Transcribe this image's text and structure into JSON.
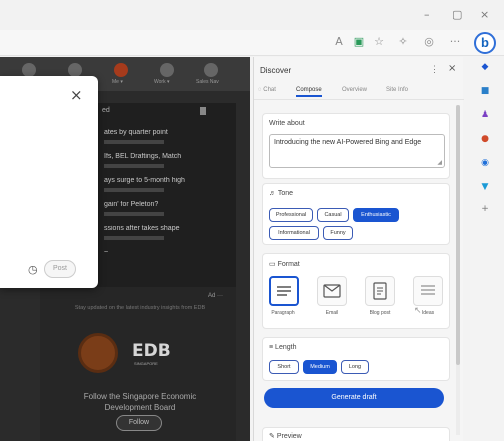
{
  "window": {
    "controls": [
      "–",
      "▢",
      "×"
    ]
  },
  "toolbar": {
    "icons": [
      "font-size-icon",
      "reading-icon",
      "tab-icon",
      "extensions-icon",
      "favorites-icon",
      "shield-icon",
      "more-icon",
      "bing-icon"
    ],
    "bing_label": "b"
  },
  "page": {
    "nav_captions": [
      "Me ▾",
      "Work ▾",
      "Sales Nav"
    ],
    "feed_number": "ed",
    "feed_items": [
      {
        "title": "ates by quarter point"
      },
      {
        "title": "Ifs, BEL Draftings, Match"
      },
      {
        "title": "ays surge to 5-month high"
      },
      {
        "title": "gain' for Peleton?"
      },
      {
        "title": "ssions after takes shape"
      }
    ],
    "feed_more": "~",
    "ad": {
      "label": "Ad ···",
      "description": "Stay updated on the latest industry insights from EDB",
      "logo_text": "EDB",
      "logo_sub": "SINGAPORE",
      "text": "Follow the Singapore Economic Development Board",
      "follow_label": "Follow"
    },
    "popup": {
      "close_label": "×",
      "clock_label": "◷",
      "post_label": "Post"
    }
  },
  "discover": {
    "title": "Discover",
    "more_label": "⋮",
    "close_label": "×",
    "tabs": [
      {
        "label": "Chat",
        "active": false
      },
      {
        "label": "Compose",
        "active": true
      },
      {
        "label": "Overview",
        "active": false
      },
      {
        "label": "Site Info",
        "active": false
      }
    ],
    "write": {
      "heading": "Write about",
      "value": "Introducing the new AI-Powered Bing and Edge"
    },
    "tone": {
      "heading": "Tone",
      "options": [
        {
          "label": "Professional",
          "selected": false
        },
        {
          "label": "Casual",
          "selected": false
        },
        {
          "label": "Enthusiastic",
          "selected": true
        },
        {
          "label": "Informational",
          "selected": false
        },
        {
          "label": "Funny",
          "selected": false
        }
      ]
    },
    "format": {
      "heading": "Format",
      "options": [
        {
          "label": "Paragraph",
          "selected": true
        },
        {
          "label": "Email",
          "selected": false
        },
        {
          "label": "Blog post",
          "selected": false
        },
        {
          "label": "Ideas",
          "selected": false
        }
      ]
    },
    "length": {
      "heading": "Length",
      "options": [
        {
          "label": "Short",
          "selected": false
        },
        {
          "label": "Medium",
          "selected": true
        },
        {
          "label": "Long",
          "selected": false
        }
      ]
    },
    "generate_label": "Generate draft",
    "preview_label": "Preview"
  },
  "edge_sidebar": {
    "icons": [
      {
        "name": "tag-icon",
        "color": "#1a55d1"
      },
      {
        "name": "briefcase-icon",
        "color": "#2a7fc9"
      },
      {
        "name": "people-icon",
        "color": "#7b3fc4"
      },
      {
        "name": "office-icon",
        "color": "#d04a2a"
      },
      {
        "name": "outlook-icon",
        "color": "#1e6fd9"
      },
      {
        "name": "send-icon",
        "color": "#1a9ad6"
      },
      {
        "name": "add-icon",
        "color": "#777777"
      }
    ]
  },
  "colors": {
    "accent": "#1a55d1",
    "page_dim": "#2b2b2b",
    "panel_bg": "#f5f5f5"
  }
}
